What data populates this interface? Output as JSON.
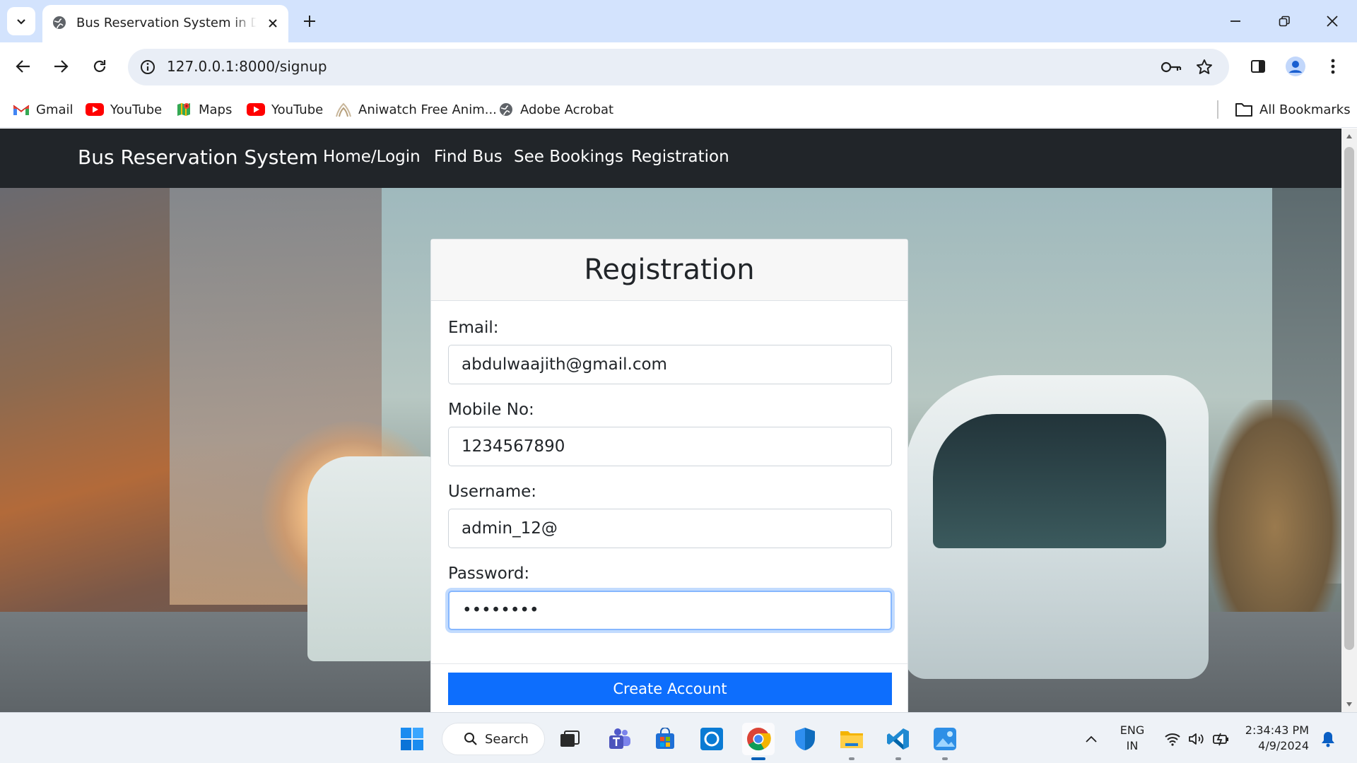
{
  "browser": {
    "tab_title": "Bus Reservation System in Django",
    "url": "127.0.0.1:8000/signup",
    "bookmarks": [
      "Gmail",
      "YouTube",
      "Maps",
      "YouTube",
      "Aniwatch Free Anim...",
      "Adobe Acrobat"
    ],
    "all_bookmarks": "All Bookmarks"
  },
  "navbar": {
    "brand": "Bus Reservation System",
    "links": [
      "Home/Login",
      "Find Bus",
      "See Bookings",
      "Registration"
    ]
  },
  "form": {
    "title": "Registration",
    "email_label": "Email:",
    "email_value": "abdulwaajith@gmail.com",
    "mobile_label": "Mobile No:",
    "mobile_value": "1234567890",
    "username_label": "Username:",
    "username_value": "admin_12@",
    "password_label": "Password:",
    "password_value": "password",
    "submit_label": "Create Account"
  },
  "taskbar": {
    "search_label": "Search",
    "language": [
      "ENG",
      "IN"
    ],
    "time": "2:34:43 PM",
    "date": "4/9/2024"
  },
  "colors": {
    "navbar_bg": "#212529",
    "primary": "#0d6efd",
    "tab_strip": "#d3e3fd"
  }
}
